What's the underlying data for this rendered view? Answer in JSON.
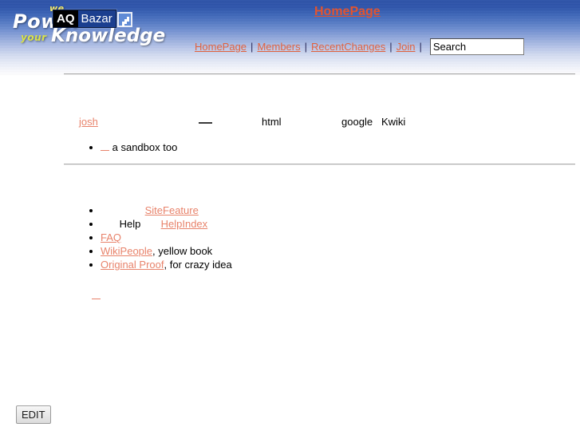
{
  "header": {
    "logo": {
      "we": "we",
      "power": "Power",
      "your": "your",
      "knowledge": "Knowledge",
      "plate_aq": "AQ",
      "plate_bazar": "Bazar"
    },
    "page_title": "HomePage",
    "title_color": "#e2542f",
    "gradient_top": "#2c52a8",
    "gradient_bottom": "#ffffff"
  },
  "nav": {
    "items": [
      {
        "label": "HomePage"
      },
      {
        "label": "Members"
      },
      {
        "label": "RecentChanges"
      },
      {
        "label": "Join"
      }
    ],
    "separator": "|",
    "search": {
      "value": "Search",
      "placeholder": "Search"
    },
    "link_color": "#e2633f"
  },
  "content": {
    "link_color": "#e8836b",
    "paragraph_1": {
      "link_josh": "josh",
      "blank_1": "",
      "dash_dark": "",
      "text_html": "html",
      "blank_2": "",
      "text_google": "google",
      "text_kwiki": "Kwiki"
    },
    "sandbox_list": [
      {
        "blank": "",
        "text": "a sandbox too"
      }
    ],
    "main_list": [
      {
        "lead": "",
        "link": "SiteFeature",
        "tail": ""
      },
      {
        "lead": "Help",
        "link": "HelpIndex",
        "tail": ""
      },
      {
        "lead": "",
        "link": "FAQ",
        "tail": ""
      },
      {
        "lead": "",
        "link": "WikiPeople",
        "tail": ", yellow book"
      },
      {
        "lead": "",
        "link": "Original Proof",
        "tail": ", for crazy idea"
      }
    ],
    "trailing_blank_link": ""
  },
  "footer": {
    "edit_label": "EDIT"
  }
}
